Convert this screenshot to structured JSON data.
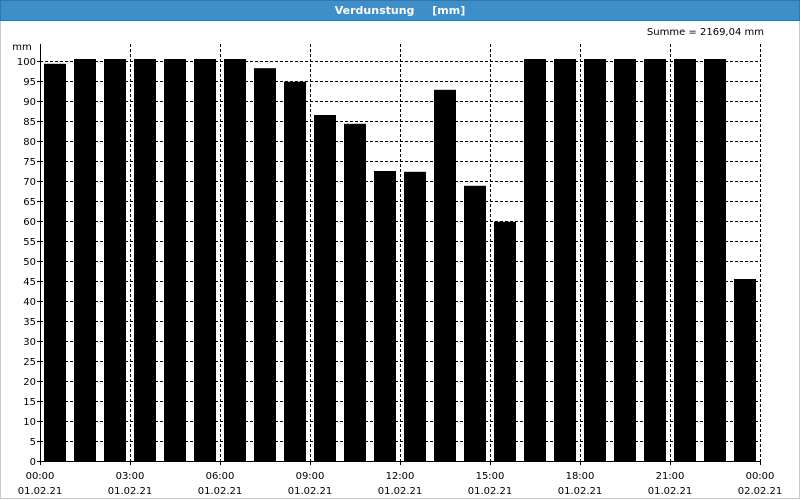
{
  "window": {
    "title": "Verdunstung",
    "unit": "[mm]"
  },
  "summary": "Summe = 2169,04 mm",
  "chart_data": {
    "type": "bar",
    "title": "Verdunstung",
    "ylabel": "mm",
    "xlabel": "",
    "ylim": [
      0,
      100
    ],
    "y_ticks": [
      0,
      5,
      10,
      15,
      20,
      25,
      30,
      35,
      40,
      45,
      50,
      55,
      60,
      65,
      70,
      75,
      80,
      85,
      90,
      95,
      100
    ],
    "x_ticks": [
      {
        "time": "00:00",
        "date": "01.02.21"
      },
      {
        "time": "03:00",
        "date": "01.02.21"
      },
      {
        "time": "06:00",
        "date": "01.02.21"
      },
      {
        "time": "09:00",
        "date": "01.02.21"
      },
      {
        "time": "12:00",
        "date": "01.02.21"
      },
      {
        "time": "15:00",
        "date": "01.02.21"
      },
      {
        "time": "18:00",
        "date": "01.02.21"
      },
      {
        "time": "21:00",
        "date": "01.02.21"
      },
      {
        "time": "00:00",
        "date": "02.02.21"
      }
    ],
    "grid": true,
    "bar_color": "#000000",
    "values": [
      99.3,
      100.5,
      100.5,
      100.5,
      100.5,
      100.5,
      100.5,
      98.2,
      94.8,
      86.5,
      84.3,
      72.5,
      72.3,
      92.8,
      68.8,
      59.8,
      100.5,
      100.5,
      100.5,
      100.5,
      100.5,
      100.5,
      100.5,
      45.5
    ]
  }
}
